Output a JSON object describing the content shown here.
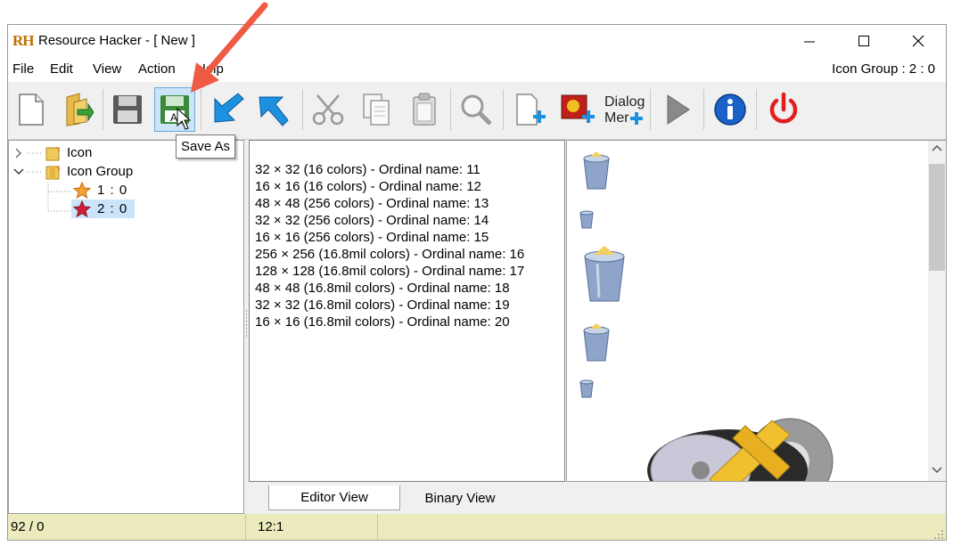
{
  "window": {
    "title": "Resource Hacker - [ New ]",
    "logo": "RH"
  },
  "menu": {
    "items": [
      "File",
      "Edit",
      "View",
      "Action",
      "Help"
    ],
    "status_right": "Icon Group : 2 : 0"
  },
  "toolbar": {
    "buttons": [
      {
        "name": "new-file",
        "icon": "blank-page-icon"
      },
      {
        "name": "open-file",
        "icon": "folder-open-icon"
      },
      {
        "name": "save",
        "icon": "floppy-disk-icon"
      },
      {
        "name": "save-as",
        "icon": "floppy-disk-a-icon"
      },
      {
        "name": "compile-back",
        "icon": "blue-arrow-left-icon"
      },
      {
        "name": "compile-forward",
        "icon": "blue-arrow-right-icon"
      },
      {
        "name": "cut",
        "icon": "scissors-icon"
      },
      {
        "name": "copy",
        "icon": "copy-icon"
      },
      {
        "name": "paste",
        "icon": "paste-icon"
      },
      {
        "name": "find",
        "icon": "magnifier-icon"
      },
      {
        "name": "add-blank-resource",
        "icon": "page-plus-icon"
      },
      {
        "name": "add-image-resource",
        "icon": "image-plus-icon"
      },
      {
        "name": "dialog-menu",
        "icon": "dialog-menu-icon"
      },
      {
        "name": "run-script",
        "icon": "play-icon"
      },
      {
        "name": "about",
        "icon": "info-icon"
      },
      {
        "name": "exit",
        "icon": "power-icon"
      }
    ],
    "dialog_label_1": "Dialog",
    "dialog_label_2": "Mer",
    "tooltip": "Save As",
    "save_as_letter": "A"
  },
  "tree": {
    "items": [
      {
        "label": "Icon",
        "expanded": false
      },
      {
        "label": "Icon Group",
        "expanded": true
      },
      {
        "label": "1 : 0"
      },
      {
        "label": "2 : 0",
        "selected": true
      }
    ]
  },
  "list": {
    "lines": [
      "32 × 32 (16 colors) - Ordinal name: 11",
      "16 × 16 (16 colors) - Ordinal name: 12",
      "48 × 48 (256 colors) - Ordinal name: 13",
      "32 × 32 (256 colors) - Ordinal name: 14",
      "16 × 16 (256 colors) - Ordinal name: 15",
      "256 × 256 (16.8mil colors) - Ordinal name: 16",
      "128 × 128 (16.8mil colors) - Ordinal name: 17",
      "48 × 48 (16.8mil colors) - Ordinal name: 18",
      "32 × 32 (16.8mil colors) - Ordinal name: 19",
      "16 × 16 (16.8mil colors) - Ordinal name: 20"
    ]
  },
  "tabs": {
    "editor": "Editor View",
    "binary": "Binary View",
    "active": "Editor View"
  },
  "status": {
    "left": "92 / 0",
    "mid": "12:1",
    "right": ""
  },
  "colors": {
    "accent": "#1e90e0",
    "status_bg": "#ebebbd",
    "selection": "#cce4f7",
    "arrow": "#ef5a45"
  }
}
